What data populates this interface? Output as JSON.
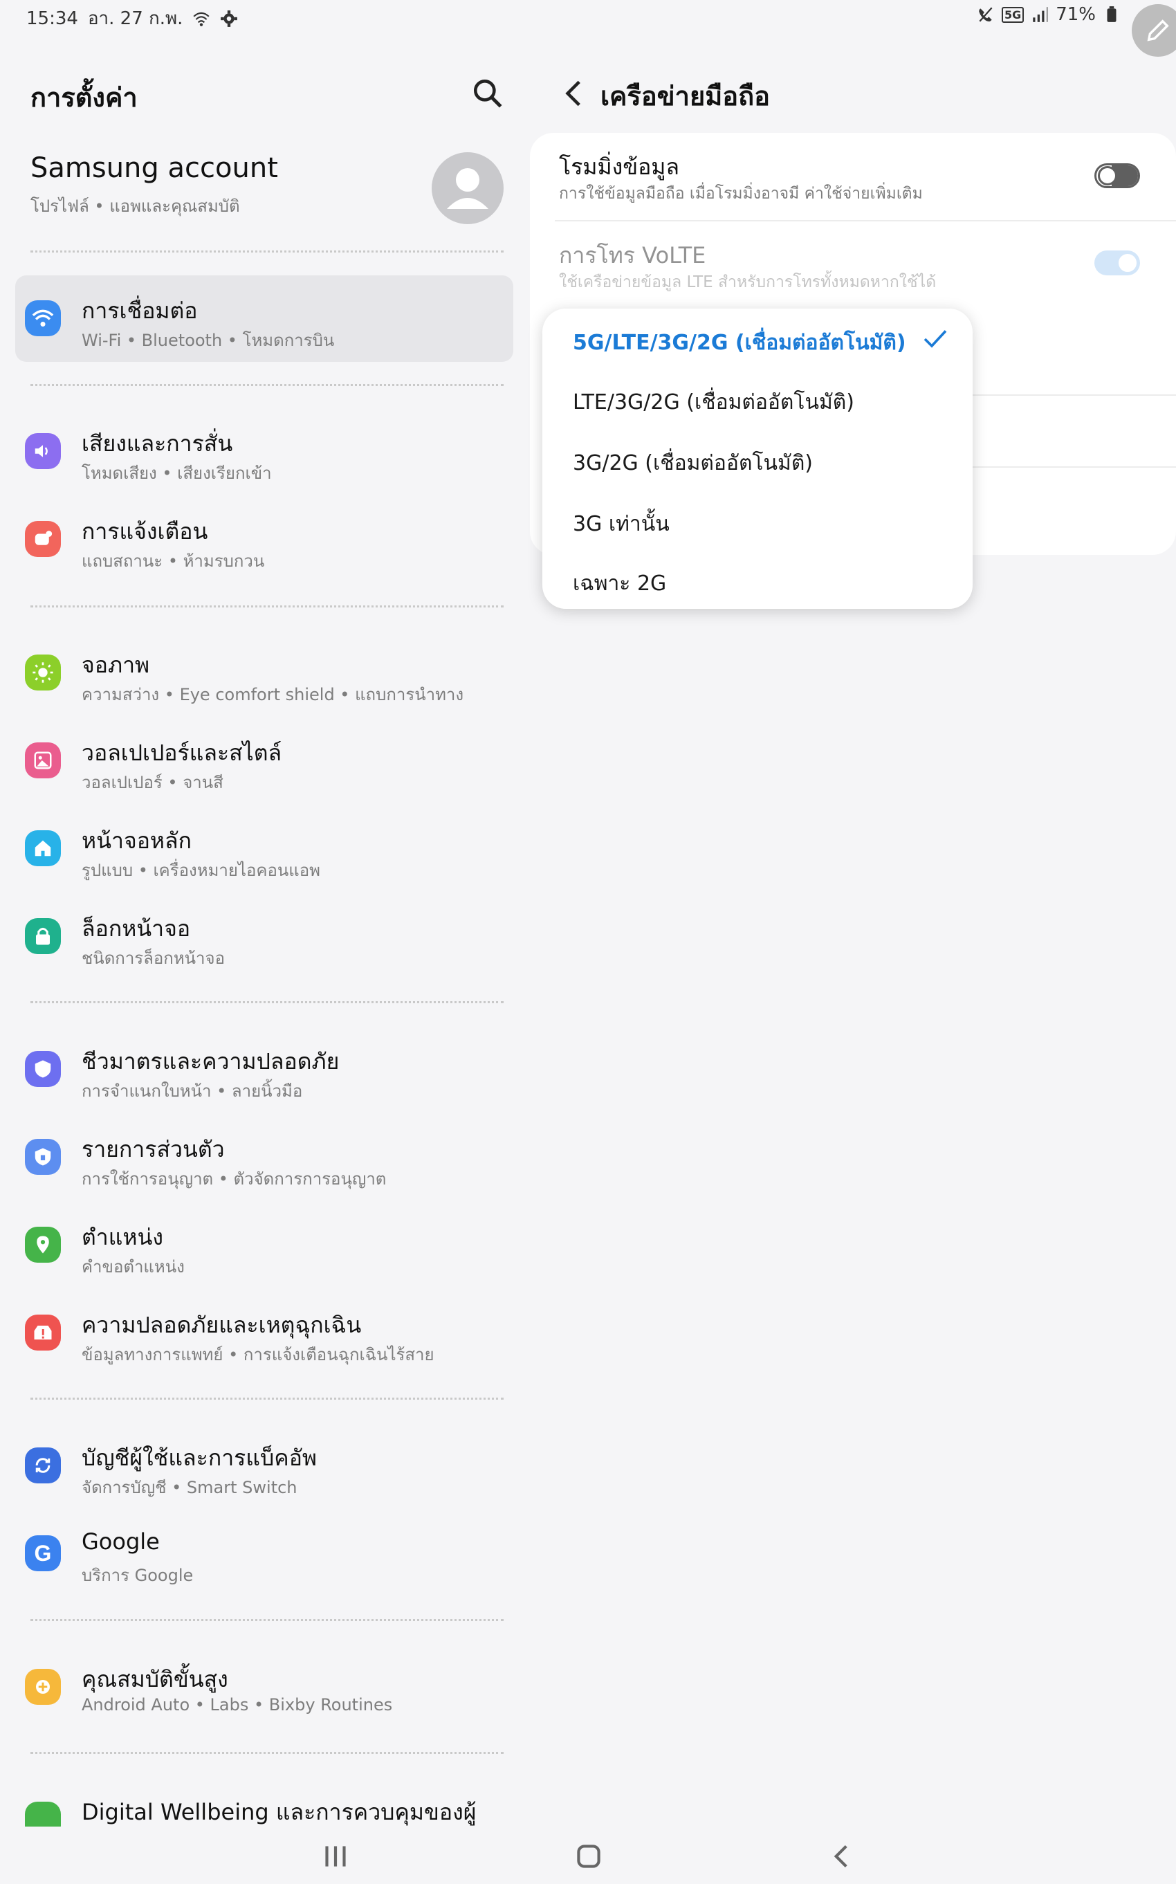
{
  "status": {
    "time": "15:34",
    "date": "อา. 27 ก.พ.",
    "battery": "71%",
    "network": "5G"
  },
  "left": {
    "title": "การตั้งค่า",
    "account": {
      "name": "Samsung account",
      "sub": "โปรไฟล์ • แอพและคุณสมบัติ"
    },
    "items": [
      {
        "title": "การเชื่อมต่อ",
        "sub": "Wi-Fi • Bluetooth • โหมดการบิน",
        "icon": "wifi-icon",
        "color": "#3b8cf0"
      },
      {
        "title": "เสียงและการสั่น",
        "sub": "โหมดเสียง • เสียงเรียกเข้า",
        "icon": "speaker-icon",
        "color": "#8c6ef0"
      },
      {
        "title": "การแจ้งเตือน",
        "sub": "แถบสถานะ • ห้ามรบกวน",
        "icon": "bell-icon",
        "color": "#f2655c"
      },
      {
        "title": "จอภาพ",
        "sub": "ความสว่าง • Eye comfort shield • แถบการนำทาง",
        "icon": "sun-icon",
        "color": "#8ccf2a"
      },
      {
        "title": "วอลเปเปอร์และสไตล์",
        "sub": "วอลเปเปอร์ • จานสี",
        "icon": "image-icon",
        "color": "#ea5d8e"
      },
      {
        "title": "หน้าจอหลัก",
        "sub": "รูปแบบ • เครื่องหมายไอคอนแอพ",
        "icon": "home-icon",
        "color": "#28b2e8"
      },
      {
        "title": "ล็อกหน้าจอ",
        "sub": "ชนิดการล็อกหน้าจอ",
        "icon": "lock-icon",
        "color": "#1fb18d"
      },
      {
        "title": "ชีวมาตรและความปลอดภัย",
        "sub": "การจำแนกใบหน้า • ลายนิ้วมือ",
        "icon": "shield-icon",
        "color": "#6d6ff0"
      },
      {
        "title": "รายการส่วนตัว",
        "sub": "การใช้การอนุญาต • ตัวจัดการการอนุญาต",
        "icon": "privacy-icon",
        "color": "#5d8ef0"
      },
      {
        "title": "ตำแหน่ง",
        "sub": "คำขอตำแหน่ง",
        "icon": "location-icon",
        "color": "#45b449"
      },
      {
        "title": "ความปลอดภัยและเหตุฉุกเฉิน",
        "sub": "ข้อมูลทางการแพทย์ • การแจ้งเตือนฉุกเฉินไร้สาย",
        "icon": "alert-icon",
        "color": "#ef5350"
      },
      {
        "title": "บัญชีผู้ใช้และการแบ็คอัพ",
        "sub": "จัดการบัญชี • Smart Switch",
        "icon": "sync-icon",
        "color": "#3b6fe0"
      },
      {
        "title": "Google",
        "sub": "บริการ Google",
        "icon": "google-icon",
        "color": "#3b82ef"
      },
      {
        "title": "คุณสมบัติขั้นสูง",
        "sub": "Android Auto • Labs • Bixby Routines",
        "icon": "gear-plus-icon",
        "color": "#f6b83b"
      },
      {
        "title": "Digital Wellbeing และการควบคุมของผู้",
        "sub": "",
        "icon": "wellbeing-icon",
        "color": "#45b449"
      }
    ]
  },
  "right": {
    "title": "เครือข่ายมือถือ",
    "rows": [
      {
        "title": "โรมมิ่งข้อมูล",
        "sub": "การใช้ข้อมูลมือถือ เมื่อโรมมิ่งอาจมี ค่าใช้จ่ายเพิ่มเติม",
        "toggle": "off"
      },
      {
        "title": "การโทร VoLTE",
        "sub": "ใช้เครือข่ายข้อมูล LTE สำหรับการโทรทั้งหมดหากใช้ได้",
        "toggle": "on"
      }
    ],
    "network_mode": {
      "selected": "5G/LTE/3G/2G (เชื่อมต่ออัตโนมัติ)",
      "options": [
        "5G/LTE/3G/2G (เชื่อมต่ออัตโนมัติ)",
        "LTE/3G/2G (เชื่อมต่ออัตโนมัติ)",
        "3G/2G (เชื่อมต่ออัตโนมัติ)",
        "3G เท่านั้น",
        "เฉพาะ 2G"
      ]
    }
  }
}
